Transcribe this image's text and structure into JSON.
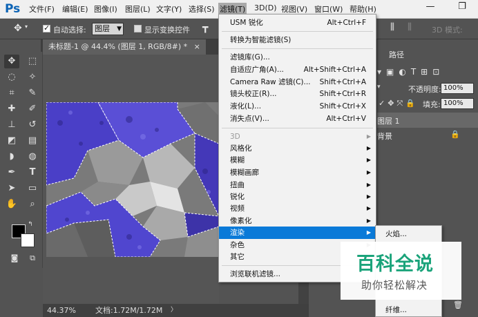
{
  "app": {
    "logo": "Ps"
  },
  "menubar": {
    "items": [
      {
        "label": "文件(F)"
      },
      {
        "label": "编辑(E)"
      },
      {
        "label": "图像(I)"
      },
      {
        "label": "图层(L)"
      },
      {
        "label": "文字(Y)"
      },
      {
        "label": "选择(S)"
      },
      {
        "label": "滤镜(T)"
      },
      {
        "label": "3D(D)"
      },
      {
        "label": "视图(V)"
      },
      {
        "label": "窗口(W)"
      },
      {
        "label": "帮助(H)"
      }
    ],
    "active_index": 6,
    "window_controls": {
      "minimize": "—",
      "restore": "❐",
      "close": "✕"
    }
  },
  "options": {
    "auto_select_label": "自动选择:",
    "auto_select_checked": true,
    "auto_select_target": "图层",
    "show_transform_label": "显示变换控件",
    "show_transform_checked": false,
    "mode_3d_label": "3D 模式:"
  },
  "document": {
    "tab_title": "未标题-1 @ 44.4% (图层 1, RGB/8#) *",
    "tab_close": "×"
  },
  "status": {
    "zoom": "44.37%",
    "doc_size": "文档:1.72M/1.72M"
  },
  "filter_menu": {
    "items": [
      {
        "label": "USM 锐化",
        "shortcut": "Alt+Ctrl+F"
      },
      {
        "label": "转换为智能滤镜(S)"
      },
      {
        "label": "滤镜库(G)..."
      },
      {
        "label": "自适应广角(A)...",
        "shortcut": "Alt+Shift+Ctrl+A"
      },
      {
        "label": "Camera Raw 滤镜(C)...",
        "shortcut": "Shift+Ctrl+A"
      },
      {
        "label": "镜头校正(R)...",
        "shortcut": "Shift+Ctrl+R"
      },
      {
        "label": "液化(L)...",
        "shortcut": "Shift+Ctrl+X"
      },
      {
        "label": "消失点(V)...",
        "shortcut": "Alt+Ctrl+V"
      },
      {
        "label": "3D",
        "submenu": true,
        "disabled": true
      },
      {
        "label": "风格化",
        "submenu": true
      },
      {
        "label": "模糊",
        "submenu": true
      },
      {
        "label": "模糊画廊",
        "submenu": true
      },
      {
        "label": "扭曲",
        "submenu": true
      },
      {
        "label": "锐化",
        "submenu": true
      },
      {
        "label": "视频",
        "submenu": true
      },
      {
        "label": "像素化",
        "submenu": true
      },
      {
        "label": "渲染",
        "submenu": true,
        "highlighted": true
      },
      {
        "label": "杂色",
        "submenu": true
      },
      {
        "label": "其它",
        "submenu": true
      },
      {
        "label": "浏览联机滤镜..."
      }
    ]
  },
  "render_submenu": {
    "items": [
      {
        "label": "火焰..."
      },
      {
        "label": "纤维..."
      }
    ]
  },
  "panels": {
    "paths_tab": "路径",
    "opacity_label": "不透明度:",
    "opacity_value": "100%",
    "fill_label": "填充:",
    "fill_value": "100%",
    "layers": [
      {
        "name": "图层 1"
      },
      {
        "name": "背景",
        "locked": true
      }
    ]
  },
  "watermark": {
    "title": "百科全说",
    "subtitle": "助你轻松解决"
  },
  "colors": {
    "accent": "#0a7ad8",
    "selection_purple": "#4a3fc7",
    "watermark_green": "#1aa37a"
  }
}
